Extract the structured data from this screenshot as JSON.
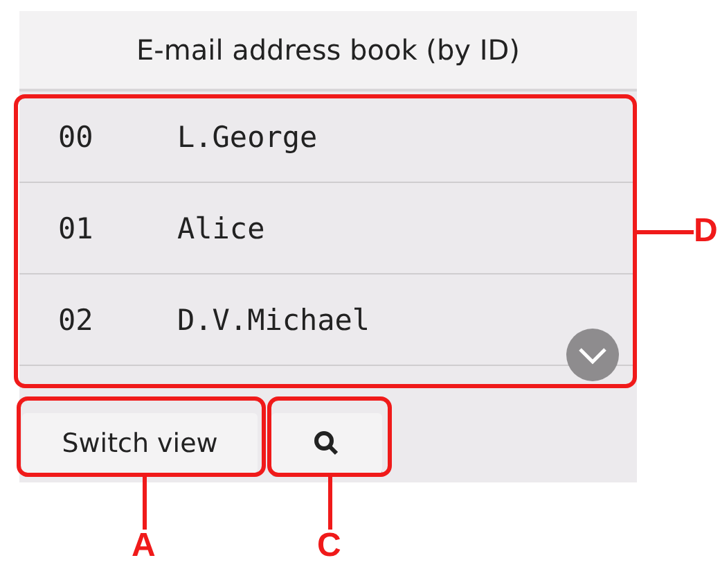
{
  "screen": {
    "title": "E-mail address book (by ID)",
    "entries": [
      {
        "id": "00",
        "name": "L.George"
      },
      {
        "id": "01",
        "name": "Alice"
      },
      {
        "id": "02",
        "name": "D.V.Michael"
      }
    ],
    "switch_view_button": "Switch view"
  },
  "callouts": [
    {
      "kind": "list",
      "label": "D"
    },
    {
      "kind": "switch",
      "label": "A"
    },
    {
      "kind": "search",
      "label": "C"
    }
  ]
}
